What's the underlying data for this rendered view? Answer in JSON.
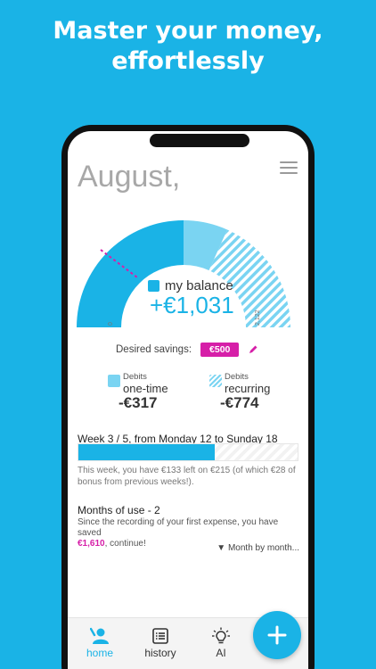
{
  "promo": {
    "headline_line1": "Master your money,",
    "headline_line2": "effortlessly"
  },
  "header": {
    "month": "August,",
    "menu_icon": "hamburger-menu-icon"
  },
  "gauge": {
    "min_label": "0",
    "max_label": "2,122",
    "balance_label": "my balance",
    "balance_value": "+€1,031"
  },
  "savings": {
    "label": "Desired savings:",
    "value": "€500",
    "edit_icon": "pencil-icon"
  },
  "debits": {
    "one_time": {
      "small": "Debits",
      "big": "one-time",
      "amount": "-€317"
    },
    "recurring": {
      "small": "Debits",
      "big": "recurring",
      "amount": "-€774"
    }
  },
  "week": {
    "title": "Week 3 / 5, from Monday 12 to Sunday 18",
    "progress_fraction": 0.62,
    "text": "This week, you have €133 left on €215 (of which €28 of bonus from previous weeks!)."
  },
  "months": {
    "title": "Months of use - 2",
    "text_before": "Since the recording of your first expense, you have saved",
    "saved_amount": "€1,610",
    "text_after": ", continue!",
    "link": "▼ Month by month..."
  },
  "tabs": [
    {
      "label": "home",
      "icon": "home-user-icon"
    },
    {
      "label": "history",
      "icon": "history-list-icon"
    },
    {
      "label": "AI",
      "icon": "lightbulb-icon"
    }
  ],
  "fab": {
    "icon": "plus-icon"
  },
  "colors": {
    "accent": "#1ab3e6",
    "accent_light": "#7ad4f2",
    "savings": "#d61fa8",
    "phone": "#111111"
  }
}
